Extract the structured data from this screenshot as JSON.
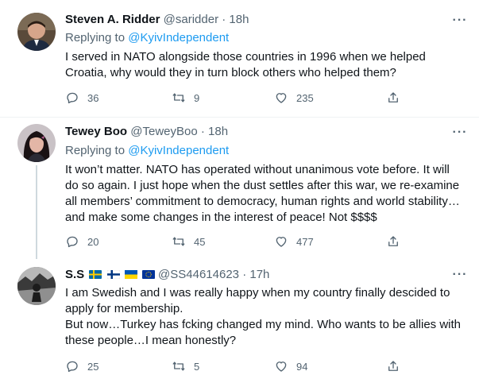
{
  "tweets": [
    {
      "name": "Steven A. Ridder",
      "handle": "@saridder",
      "dot": "·",
      "time": "18h",
      "replying_prefix": "Replying to ",
      "replying_to": "@KyivIndependent",
      "text": "I served in NATO alongside those countries in 1996 when we helped\nCroatia, why would they in turn block others who helped them?",
      "replies": "36",
      "retweets": "9",
      "likes": "235"
    },
    {
      "name": "Tewey Boo",
      "handle": "@TeweyBoo",
      "dot": "·",
      "time": "18h",
      "replying_prefix": "Replying to ",
      "replying_to": "@KyivIndependent",
      "text": "It won’t matter. NATO has operated without unanimous vote before. It will\ndo so again. I just hope when the dust settles after this war, we re-examine\nall members’ commitment to democracy, human rights and world stability…\nand make some changes in the interest of peace! Not $$$$",
      "replies": "20",
      "retweets": "45",
      "likes": "477"
    },
    {
      "name": "S.S",
      "handle": "@SS44614623",
      "dot": "·",
      "time": "17h",
      "text": "I am Swedish and I was really happy when my country finally descided to\napply for membership.\nBut now…Turkey has fcking changed my mind. Who wants to be allies with\nthese people…I mean honestly?",
      "replies": "25",
      "retweets": "5",
      "likes": "94"
    }
  ],
  "more_glyph": "···",
  "colors": {
    "accent": "#1d9bf0",
    "secondary_text": "#536471",
    "primary_text": "#0f1419",
    "divider": "#eff3f4"
  },
  "icons": [
    "reply-icon",
    "retweet-icon",
    "like-icon",
    "share-icon",
    "more-icon",
    "sweden-flag",
    "finland-flag",
    "ukraine-flag",
    "eu-flag"
  ]
}
